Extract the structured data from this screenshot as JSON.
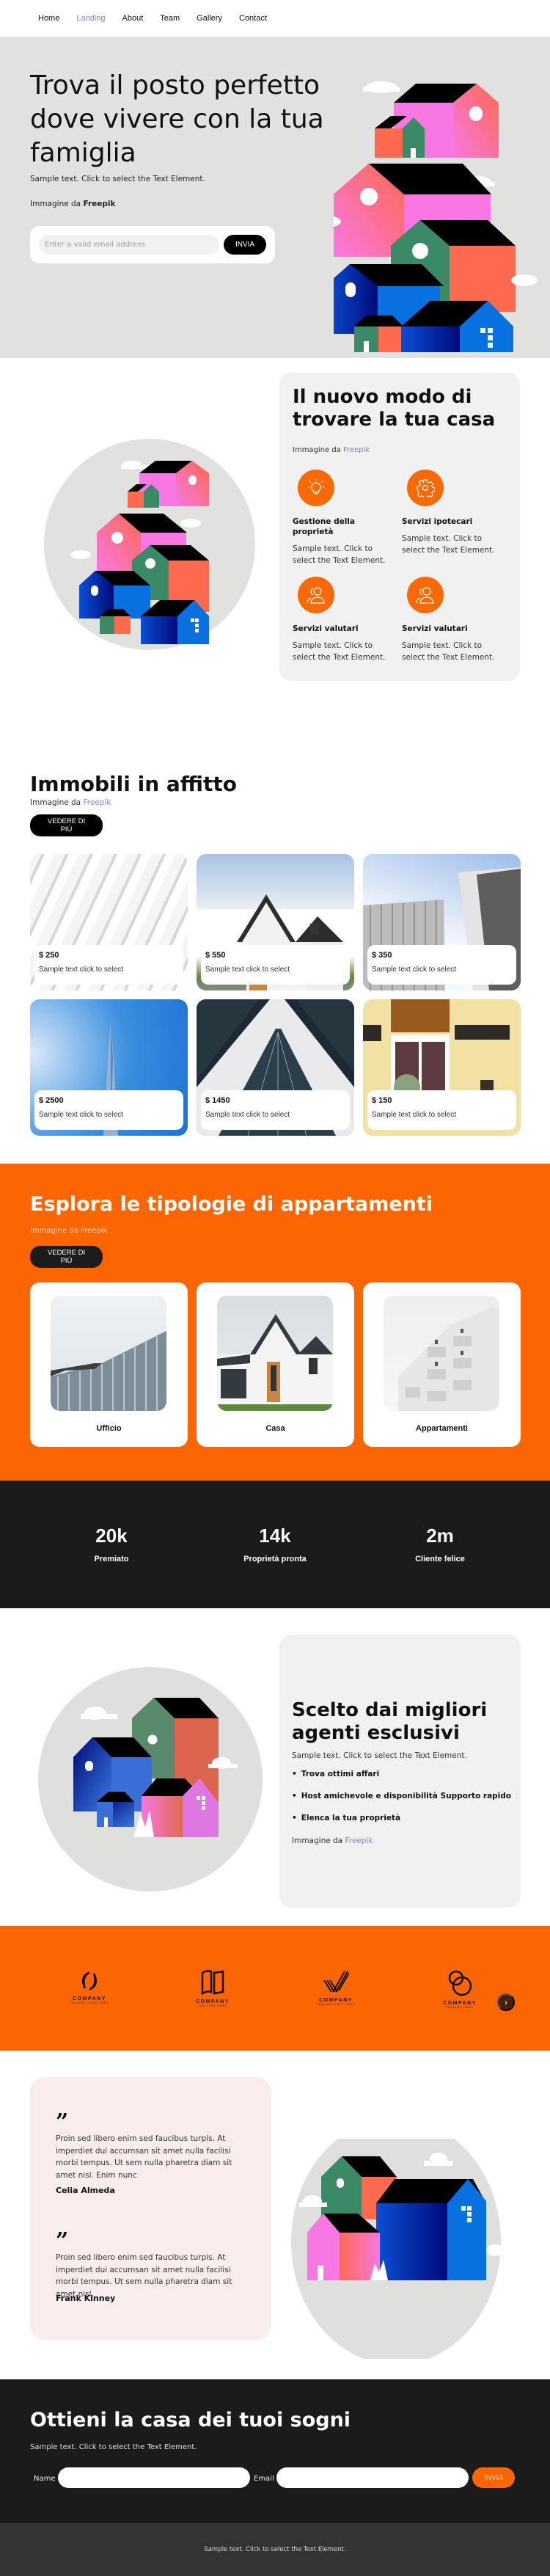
{
  "nav": {
    "items": [
      {
        "label": "Home",
        "active": false
      },
      {
        "label": "Landing",
        "active": true
      },
      {
        "label": "About",
        "active": false
      },
      {
        "label": "Team",
        "active": false
      },
      {
        "label": "Gallery",
        "active": false
      },
      {
        "label": "Contact",
        "active": false
      }
    ]
  },
  "hero": {
    "title": "Trova il posto perfetto dove vivere con la tua famiglia",
    "subtitle": "Sample text. Click to select the Text Element.",
    "credit_prefix": "Immagine da",
    "credit_link": "Freepik",
    "email_placeholder": "Enter a valid email address",
    "submit_label": "INVIA"
  },
  "about": {
    "title": "Il nuovo modo di trovare la tua casa",
    "credit_prefix": "Immagine da",
    "credit_link": "Freepik",
    "features": [
      {
        "icon": "lightbulb-icon",
        "title": "Gestione della proprietà",
        "text": "Sample text. Click to select the Text Element."
      },
      {
        "icon": "gear-icon",
        "title": "Servizi ipotecari",
        "text": "Sample text. Click to select the Text Element."
      },
      {
        "icon": "users-icon",
        "title": "Servizi valutari",
        "text": "Sample text. Click to select the Text Element."
      },
      {
        "icon": "users-icon",
        "title": "Servizi valutari",
        "text": "Sample text. Click to select the Text Element."
      }
    ]
  },
  "rentals": {
    "title": "Immobili in affitto",
    "credit_prefix": "Immagine da",
    "credit_link": "Freepik",
    "button_label": "VEDERE DI PIÙ",
    "items": [
      {
        "price": "$ 250",
        "text": "Sample text click to select",
        "image": "white-arches"
      },
      {
        "price": "$ 550",
        "text": "Sample text click to select",
        "image": "house-sky"
      },
      {
        "price": "$ 350",
        "text": "Sample text click to select",
        "image": "towers"
      },
      {
        "price": "$ 2500",
        "text": "Sample text click to select",
        "image": "skyscraper-blue"
      },
      {
        "price": "$ 1450",
        "text": "Sample text click to select",
        "image": "dark-tower"
      },
      {
        "price": "$ 150",
        "text": "Sample text click to select",
        "image": "yellow-facade"
      }
    ]
  },
  "types": {
    "title": "Esplora le tipologie di appartamenti",
    "credit": "Immagine da Freepik",
    "button_label": "VEDERE DI PIÙ",
    "items": [
      {
        "label": "Ufficio"
      },
      {
        "label": "Casa"
      },
      {
        "label": "Appartamenti"
      }
    ]
  },
  "stats": {
    "items": [
      {
        "value": "20k",
        "label": "Premiato"
      },
      {
        "value": "14k",
        "label": "Proprietà pronta"
      },
      {
        "value": "2m",
        "label": "Cliente felice"
      }
    ]
  },
  "agents": {
    "title": "Scelto dai migliori agenti esclusivi",
    "subtitle": "Sample text. Click to select the Text Element.",
    "bullets": [
      "Trova ottimi affari",
      "Host amichevole e disponibilità Supporto rapido",
      "Elenca la tua proprietà"
    ],
    "credit_prefix": "Immagine da",
    "credit_link": "Freepik"
  },
  "logos": {
    "items": [
      {
        "word": "COMPANY",
        "tag": "TAGLINE GOES HERE"
      },
      {
        "word": "COMPANY",
        "tag": "TAG LINE HERE"
      },
      {
        "word": "COMPANY",
        "tag": "TAGLINE GOES HERE"
      },
      {
        "word": "COMPANY",
        "tag": "TAGLINE HERE"
      }
    ],
    "next_glyph": "›"
  },
  "testimonials": {
    "quote_glyph": "”",
    "items": [
      {
        "text": "Proin sed libero enim sed faucibus turpis. At imperdiet dui accumsan sit amet nulla facilisi morbi tempus. Ut sem nulla pharetra diam sit amet nisl. Enim nunc",
        "name": "Celia Almeda"
      },
      {
        "text": "Proin sed libero enim sed faucibus turpis. At imperdiet dui accumsan sit amet nulla facilisi morbi tempus. Ut sem nulla pharetra diam sit amet nisl.",
        "name": "Frank Kinney"
      }
    ]
  },
  "cta": {
    "title": "Ottieni la casa dei tuoi sogni",
    "subtitle": "Sample text. Click to select the Text Element.",
    "name_label": "Name",
    "email_label": "Email",
    "submit_label": "INVIA"
  },
  "footer": {
    "text": "Sample text. Click to select the Text Element."
  },
  "colors": {
    "accent": "#fb6603",
    "dark": "#1b1b1b",
    "link": "#8a7fc8",
    "hero_bg": "#e1e1df",
    "card_bg": "#f1f1f1",
    "testimonial_bg": "#f9eced"
  }
}
